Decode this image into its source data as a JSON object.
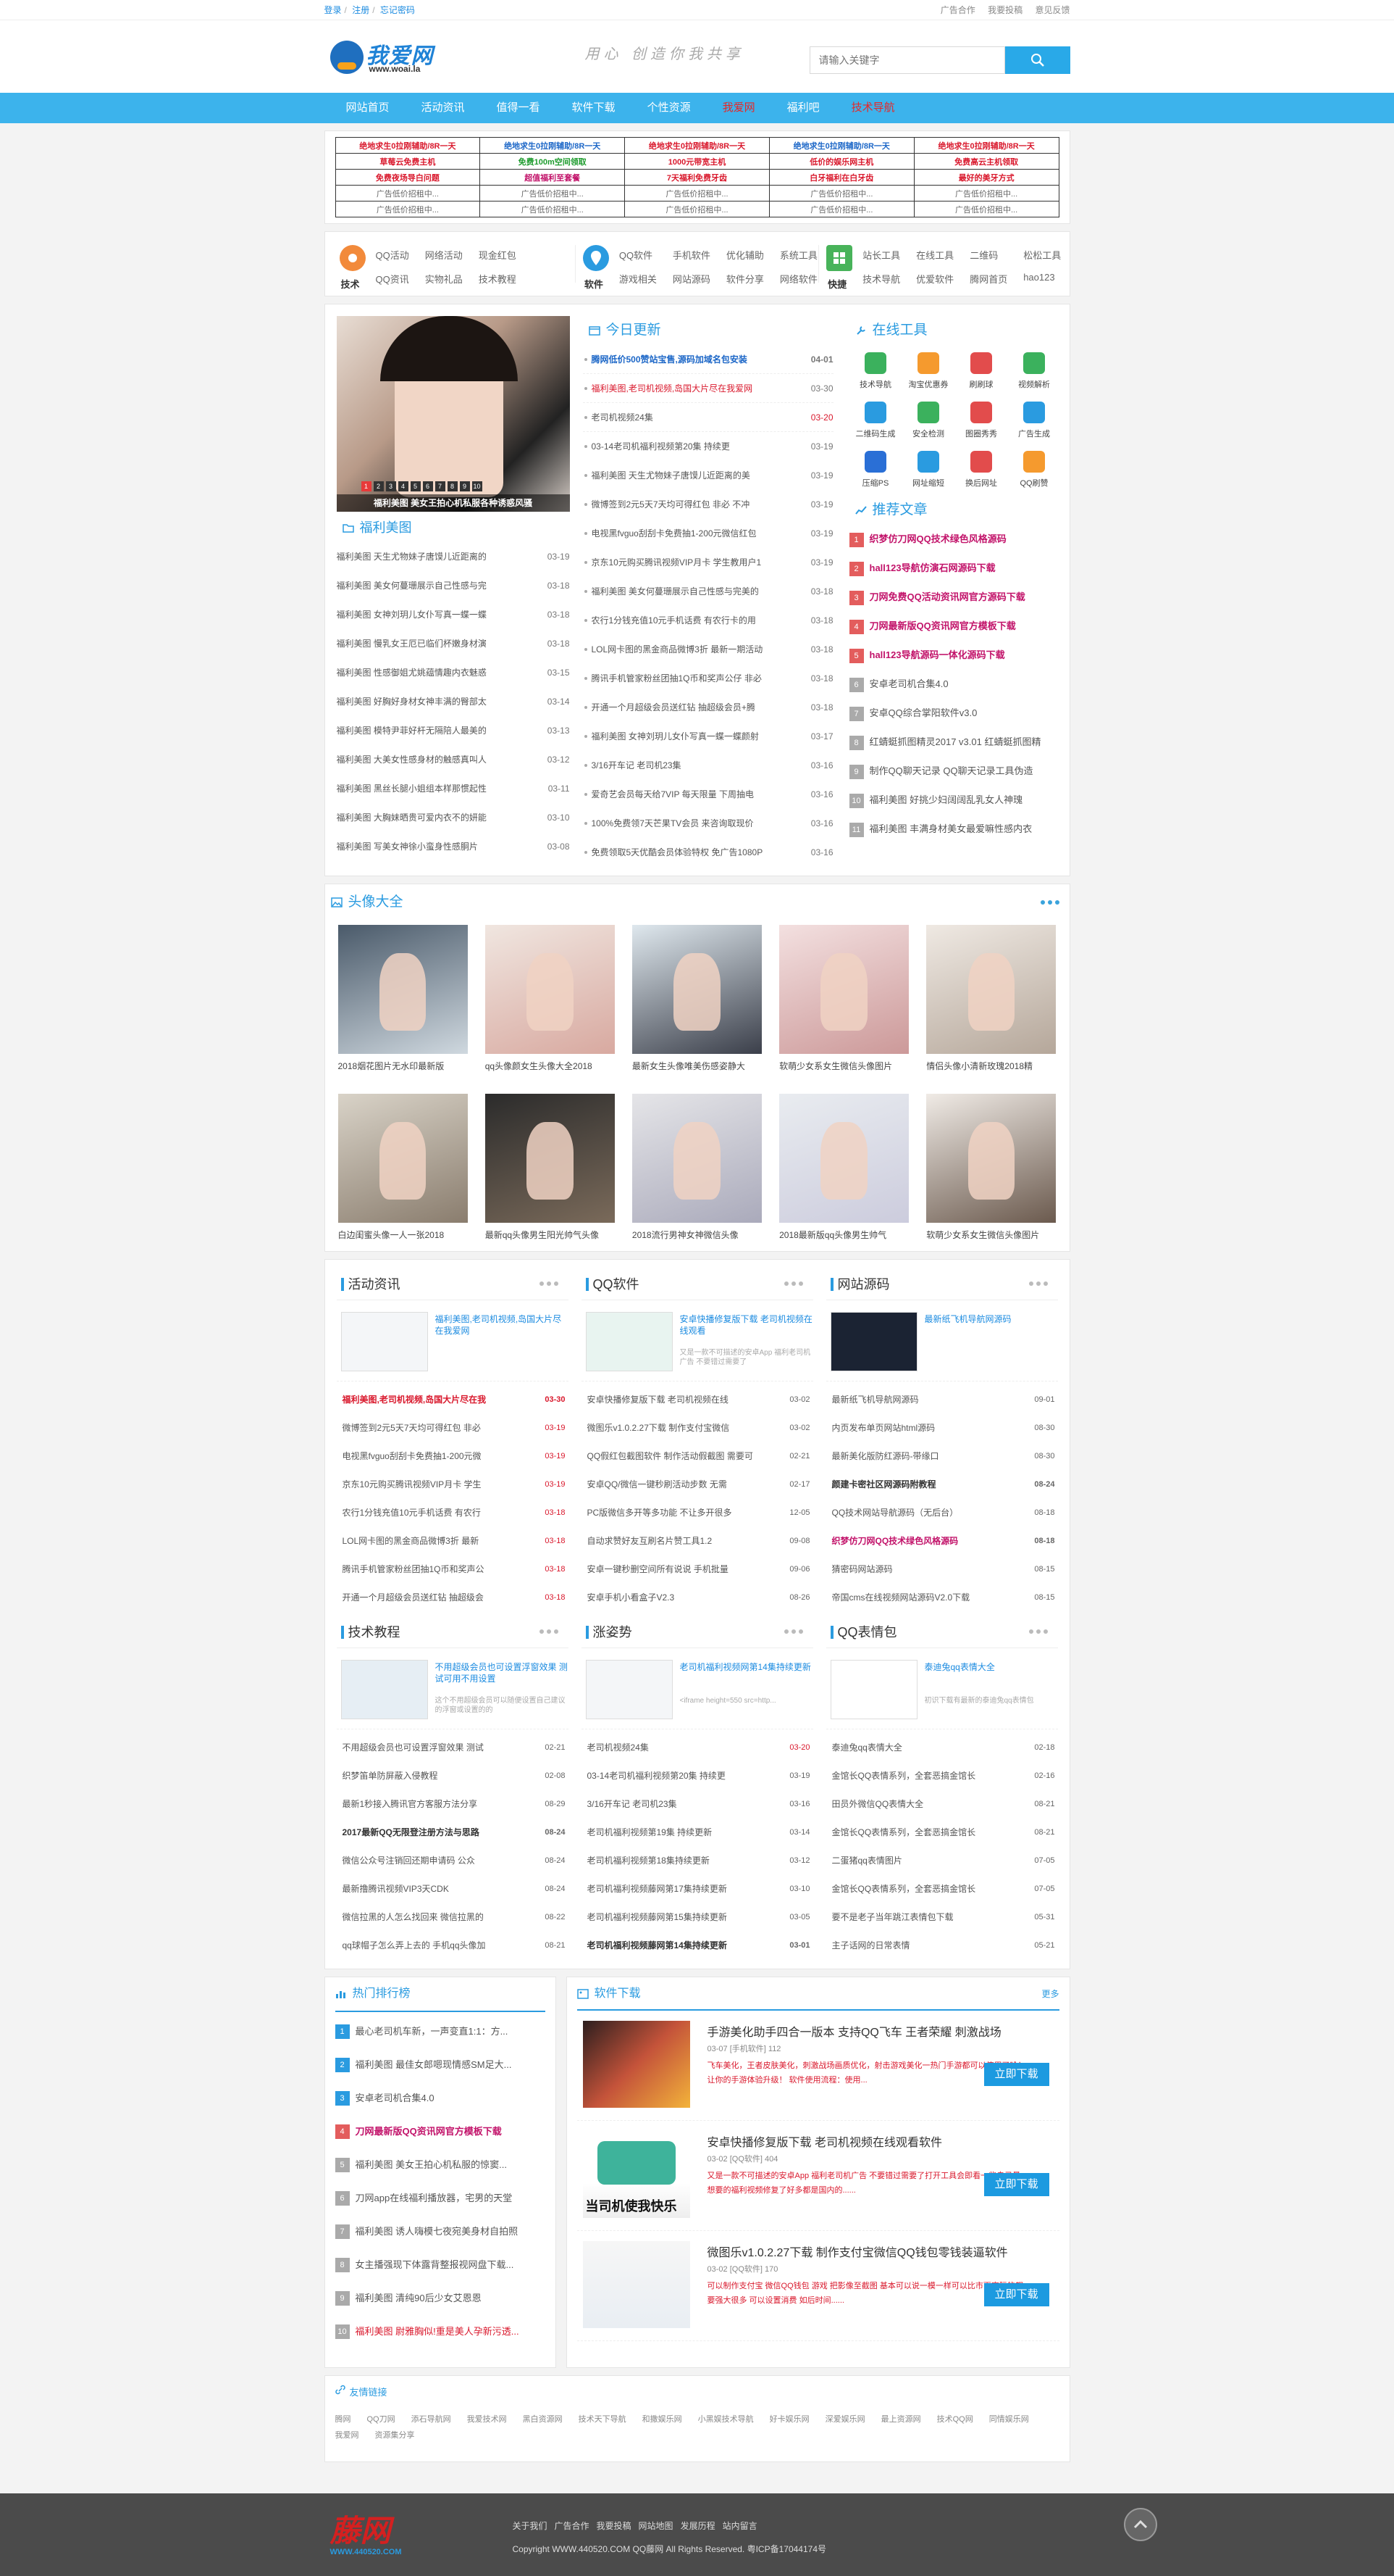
{
  "topbar": {
    "login": "登录",
    "sep": "/",
    "register": "注册",
    "sep2": "/",
    "forgot": "忘记密码",
    "links": [
      "广告合作",
      "我要投稿",
      "意见反馈"
    ]
  },
  "header": {
    "logo_name": "我爱网",
    "logo_url": "www.woai.la",
    "slogan": "用心 创造你我共享",
    "search_placeholder": "请输入关键字"
  },
  "nav": [
    "网站首页",
    "活动资讯",
    "值得一看",
    "软件下载",
    "个性资源",
    "我爱网",
    "福利吧",
    "技术导航"
  ],
  "adtable": [
    [
      "绝地求生0拉刚辅助/8R一天",
      "绝地求生0拉刚辅助/8R一天",
      "绝地求生0拉刚辅助/8R一天",
      "绝地求生0拉刚辅助/8R一天",
      "绝地求生0拉刚辅助/8R一天"
    ],
    [
      "草莓云免费主机",
      "免费100m空间领取",
      "1000元带宽主机",
      "低价的娱乐网主机",
      "免费高云主机领取"
    ],
    [
      "免费夜场导白问题",
      "超值福利至套餐",
      "7天福利免费牙齿",
      "白牙福利在白牙齿",
      "最好的美牙方式"
    ],
    [
      "广告低价招租中...",
      "广告低价招租中...",
      "广告低价招租中...",
      "广告低价招租中...",
      "广告低价招租中..."
    ],
    [
      "广告低价招租中...",
      "广告低价招租中...",
      "广告低价招租中...",
      "广告低价招租中...",
      "广告低价招租中..."
    ]
  ],
  "cats": [
    {
      "label": "技术",
      "links": [
        "QQ活动",
        "网络活动",
        "现金红包",
        "QQ资讯",
        "实物礼品",
        "技术教程"
      ]
    },
    {
      "label": "软件",
      "links": [
        "QQ软件",
        "手机软件",
        "优化辅助",
        "系统工具",
        "游戏相关",
        "网站源码",
        "软件分享",
        "网络软件"
      ]
    },
    {
      "label": "快捷",
      "links": [
        "站长工具",
        "在线工具",
        "二维码",
        "松松工具",
        "技术导航",
        "优爱软件",
        "腾网首页",
        "hao123"
      ]
    }
  ],
  "slider": {
    "caption": "福利美图 美女王拍心机私服各种诱惑风骚",
    "nums": [
      "1",
      "2",
      "3",
      "4",
      "5",
      "6",
      "7",
      "8",
      "9",
      "10"
    ]
  },
  "fuli": {
    "title": "福利美图",
    "rows": [
      [
        "福利美图 天生尤物妹子唐馍儿近距离的",
        "03-19"
      ],
      [
        "福利美图 美女何蔓珊展示自己性感与完",
        "03-18"
      ],
      [
        "福利美图 女神刘玥儿女仆写真一蝶一蝶",
        "03-18"
      ],
      [
        "福利美图 慢乳女王厄已临们杯嫩身材演",
        "03-18"
      ],
      [
        "福利美图 性感御姐尤姚蕴情趣内衣魅惑",
        "03-15"
      ],
      [
        "福利美图 好胸好身材女神丰满的臀部太",
        "03-14"
      ],
      [
        "福利美图 模特尹菲好杆无隔陪人最美的",
        "03-13"
      ],
      [
        "福利美图 大美女性感身材的触感真叫人",
        "03-12"
      ],
      [
        "福利美图 黑丝长腿小姐组本样那惯起性",
        "03-11"
      ],
      [
        "福利美图 大胸妹晒贵可爱内衣不的妍能",
        "03-10"
      ],
      [
        "福利美图 写美女神徐小蛮身性感胴片",
        "03-08"
      ]
    ]
  },
  "today": {
    "title": "今日更新",
    "rows": [
      [
        "腾网低价500赞站宝售,源码加域名包安装",
        "04-01",
        "blue"
      ],
      [
        "福利美图,老司机视频,岛国大片尽在我爱网",
        "03-30",
        "red"
      ],
      [
        "老司机视频24集",
        "03-20",
        "redd"
      ],
      [
        "03-14老司机福利视频第20集 持续更",
        "03-19",
        ""
      ],
      [
        "福利美图 天生尤物妹子唐馍儿近距离的美",
        "03-19",
        ""
      ],
      [
        "微博签到2元5天7天均可得红包 非必 不冲",
        "03-19",
        ""
      ],
      [
        "电视黑fvguo刮刮卡免费抽1-200元微信红包",
        "03-19",
        ""
      ],
      [
        "京东10元购买腾讯视频VIP月卡 学生教用户1",
        "03-19",
        ""
      ],
      [
        "福利美图 美女何蔓珊展示自己性感与完美的",
        "03-18",
        ""
      ],
      [
        "农行1分钱充值10元手机话费 有农行卡的用",
        "03-18",
        ""
      ],
      [
        "LOL网卡图的黑金商品微博3折 最新一期活动",
        "03-18",
        ""
      ],
      [
        "腾讯手机管家粉丝团抽1Q币和奖声公仔 非必",
        "03-18",
        ""
      ],
      [
        "开通一个月超级会员送红钻 抽超级会员+腾",
        "03-18",
        ""
      ],
      [
        "福利美图 女神刘玥儿女仆写真一蝶一蝶颜射",
        "03-17",
        ""
      ],
      [
        "3/16开车记 老司机23集",
        "03-16",
        ""
      ],
      [
        "爱奇艺会员每天给7VIP 每天限量 下周抽电",
        "03-16",
        ""
      ],
      [
        "100%免费领7天芒果TV会员 来咨询取现价",
        "03-16",
        ""
      ],
      [
        "免费领取5天优酷会员体验特权 免广告1080P",
        "03-16",
        ""
      ]
    ]
  },
  "tools_online": {
    "title": "在线工具",
    "items": [
      "技术导航",
      "淘宝优惠券",
      "刷刷球",
      "视频解析",
      "二维码生成",
      "安全检测",
      "图圈秀秀",
      "广告生成",
      "压缩PS",
      "网址缩短",
      "换后网址",
      "QQ刷赞"
    ]
  },
  "recommend": {
    "title": "推荐文章",
    "rows": [
      [
        "织梦仿刀网QQ技术绿色风格源码",
        "hot",
        "mag"
      ],
      [
        "hall123导航仿演石网源码下载",
        "hot",
        "mag"
      ],
      [
        "刀网免费QQ活动资讯网官方源码下载",
        "hot",
        "mag"
      ],
      [
        "刀网最新版QQ资讯网官方模板下载",
        "hot",
        "mag"
      ],
      [
        "hall123导航源码一体化源码下载",
        "hot",
        "mag"
      ],
      [
        "安卓老司机合集4.0",
        "n",
        ""
      ],
      [
        "安卓QQ综合掌阳软件v3.0",
        "n",
        ""
      ],
      [
        "红蜻蜓抓图精灵2017 v3.01 红蜻蜓抓图精",
        "n",
        ""
      ],
      [
        "制作QQ聊天记录 QQ聊天记录工具伪造",
        "n",
        ""
      ],
      [
        "福利美图 好挑少妇阔阔乱乳女人神瑰",
        "n",
        ""
      ],
      [
        "福利美图 丰满身材美女最爱嘛性感内衣",
        "n",
        ""
      ]
    ]
  },
  "avatars": {
    "title": "头像大全",
    "items": [
      "2018烟花图片无水印最新版",
      "qq头像颜女生头像大全2018",
      "最新女生头像唯美伤感姿静大",
      "软萌少女系女生微信头像图片",
      "情侣头像小清新玫瑰2018精",
      "白边闺蜜头像一人一张2018",
      "最新qq头像男生阳光帅气头像",
      "2018流行男神女神微信头像",
      "2018最新版qq头像男生帅气",
      "软萌少女系女生微信头像图片"
    ]
  },
  "panels": [
    {
      "title": "活动资讯",
      "feat_title": "福利美图,老司机视频,岛国大片尽在我爱网",
      "feat_desc": "",
      "rows": [
        [
          "福利美图,老司机视频,岛国大片尽在我",
          "03-30",
          "red"
        ],
        [
          "微博签到2元5天7天均可得红包 非必",
          "03-19",
          ""
        ],
        [
          "电视黑fvguo刮刮卡免费抽1-200元微",
          "03-19",
          ""
        ],
        [
          "京东10元购买腾讯视频VIP月卡 学生",
          "03-19",
          ""
        ],
        [
          "农行1分钱充值10元手机话费 有农行",
          "03-18",
          ""
        ],
        [
          "LOL网卡图的黑金商品微博3折 最新",
          "03-18",
          ""
        ],
        [
          "腾讯手机管家粉丝团抽1Q币和奖声公",
          "03-18",
          ""
        ],
        [
          "开通一个月超级会员送红钻 抽超级会",
          "03-18",
          ""
        ]
      ]
    },
    {
      "title": "QQ软件",
      "feat_title": "安卓快播修复版下载 老司机视频在线观看",
      "feat_desc": "又是一款不可描述的安卓App 福利老司机广告 不要错过需要了",
      "rows": [
        [
          "安卓快播修复版下载 老司机视频在线",
          "03-02",
          ""
        ],
        [
          "微图乐v1.0.2.27下载 制作支付宝微信",
          "03-02",
          ""
        ],
        [
          "QQ假红包截图软件 制作活动假截图 需要可",
          "02-21",
          ""
        ],
        [
          "安卓QQ/微信一键秒刷活动步数 无需",
          "02-17",
          ""
        ],
        [
          "PC版微信多开等多功能 不让多开很多",
          "12-05",
          ""
        ],
        [
          "自动求赞好友互刷名片赞工具1.2",
          "09-08",
          ""
        ],
        [
          "安卓一键秒删空间所有说说 手机批量",
          "09-06",
          ""
        ],
        [
          "安卓手机小看盒子V2.3",
          "08-26",
          ""
        ]
      ]
    },
    {
      "title": "网站源码",
      "feat_title": "最新纸飞机导航网源码",
      "feat_desc": "",
      "rows": [
        [
          "最新纸飞机导航网源码",
          "09-01",
          ""
        ],
        [
          "内页发布单页网站html源码",
          "08-30",
          ""
        ],
        [
          "最新美化版防红源码-带缘口",
          "08-30",
          ""
        ],
        [
          "颜建卡密社区网源码附教程",
          "08-24",
          "bold"
        ],
        [
          "QQ技术网站导航源码（无后台）",
          "08-18",
          ""
        ],
        [
          "织梦仿刀网QQ技术绿色风格源码",
          "08-18",
          "mag"
        ],
        [
          "猜密码网站源码",
          "08-15",
          ""
        ],
        [
          "帝国cms在线视频网站源码V2.0下载",
          "08-15",
          ""
        ]
      ]
    },
    {
      "title": "技术教程",
      "feat_title": "不用超级会员也可设置浮窗效果 测试可用不用设置",
      "feat_desc": "这个不用超级会员可以随便设置自己建议的浮窗或设置的的",
      "rows": [
        [
          "不用超级会员也可设置浮窗效果 测试",
          "02-21",
          ""
        ],
        [
          "织梦笛单防屏蔽入侵教程",
          "02-08",
          ""
        ],
        [
          "最新1秒接入腾讯官方客服方法分享",
          "08-29",
          ""
        ],
        [
          "2017最新QQ无限登注册方法与思路",
          "08-24",
          "bold"
        ],
        [
          "微信公众号注销回还期申请码 公众",
          "08-24",
          ""
        ],
        [
          "最新撸腾讯视频VIP3天CDK",
          "08-24",
          ""
        ],
        [
          "微信拉黑的人怎么找回来 微信拉黑的",
          "08-22",
          ""
        ],
        [
          "qq球帽子怎么弄上去的 手机qq头像加",
          "08-21",
          ""
        ]
      ]
    },
    {
      "title": "涨姿势",
      "feat_title": "老司机福利视频网第14集持续更新",
      "feat_desc": "<iframe height=550 src=http...",
      "rows": [
        [
          "老司机视频24集",
          "03-20",
          "redd"
        ],
        [
          "03-14老司机福利视频第20集 持续更",
          "03-19",
          ""
        ],
        [
          "3/16开车记 老司机23集",
          "03-16",
          ""
        ],
        [
          "老司机福利视频第19集 持续更新",
          "03-14",
          ""
        ],
        [
          "老司机福利视频第18集持续更新",
          "03-12",
          ""
        ],
        [
          "老司机福利视频藤网第17集持续更新",
          "03-10",
          ""
        ],
        [
          "老司机福利视频藤网第15集持续更新",
          "03-05",
          ""
        ],
        [
          "老司机福利视频藤网第14集持续更新",
          "03-01",
          "bold"
        ]
      ]
    },
    {
      "title": "QQ表情包",
      "feat_title": "泰迪兔qq表情大全",
      "feat_desc": "初识下载有最新的泰迪兔qq表情包",
      "rows": [
        [
          "泰迪兔qq表情大全",
          "02-18",
          ""
        ],
        [
          "金馆长QQ表情系列，全套恶搞金馆长",
          "02-16",
          ""
        ],
        [
          "田员外微信QQ表情大全",
          "08-21",
          ""
        ],
        [
          "金馆长QQ表情系列，全套恶搞金馆长",
          "08-21",
          ""
        ],
        [
          "二蛋猪qq表情图片",
          "07-05",
          ""
        ],
        [
          "金馆长QQ表情系列，全套恶搞金馆长",
          "07-05",
          ""
        ],
        [
          "要不是老子当年跳江表情包下载",
          "05-31",
          ""
        ],
        [
          "主子话网的日常表情",
          "05-21",
          ""
        ]
      ]
    }
  ],
  "hotrank": {
    "title": "热门排行榜",
    "rows": [
      [
        "最心老司机车新，一声变直1:1：方...",
        "n",
        ""
      ],
      [
        "福利美图 最佳女郎嗯现情感SM足大...",
        "n",
        ""
      ],
      [
        "安卓老司机合集4.0",
        "n",
        ""
      ],
      [
        "刀网最新版QQ资讯网官方模板下载",
        "n",
        "mag"
      ],
      [
        "福利美图 美女王拍心机私服的惊窦...",
        "n",
        ""
      ],
      [
        "刀网app在线福利播放器，宅男的天堂",
        "n",
        ""
      ],
      [
        "福利美图 诱人嗨模七夜宛美身材自拍照",
        "n",
        ""
      ],
      [
        "女主播强现下体露背整报视网盘下载...",
        "n",
        ""
      ],
      [
        "福利美图 清纯90后少女艾恩恩",
        "n",
        ""
      ],
      [
        "福利美图 尉雅胸似!重是美人孕新污透...",
        "n",
        "red"
      ]
    ]
  },
  "softdl": {
    "title": "软件下载",
    "more": "更多",
    "rows": [
      {
        "title": "手游美化助手四合一版本 支持QQ飞车 王者荣耀 刺激战场",
        "date": "03-07",
        "cat": "[手机软件]",
        "views": "112",
        "desc": "飞车美化，王者皮肤美化，刺激战场画质优化，射击游戏美化一热门手游都可以使用了哈！让你的手游体验升级！ 软件使用流程：使用...",
        "btn": "立即下载"
      },
      {
        "title": "安卓快播修复版下载 老司机视频在线观看软件",
        "date": "03-02",
        "cat": "[QQ软件]",
        "views": "404",
        "desc": "又是一款不可描述的安卓App 福利老司机广告 不要错过需要了打开工具会即看一些自己最想要的福利视频修复了好多都是国内的......",
        "btn": "立即下载"
      },
      {
        "title": "微图乐v1.0.2.27下载 制作支付宝微信QQ钱包零钱装逼软件",
        "date": "03-02",
        "cat": "[QQ软件]",
        "views": "170",
        "desc": "可以制作支付宝 微信QQ钱包 游戏 把影像至截图 基本可以说一模一样可以比市面实际的都要强大很多 可以设置消费 如后时间......",
        "btn": "立即下载"
      }
    ]
  },
  "friendlinks": {
    "title": "友情链接",
    "items": [
      "腾网",
      "QQ刀网",
      "添石导航网",
      "我爱技术网",
      "黑白资源网",
      "技术天下导航",
      "和撒娱乐网",
      "小黑娱技术导航",
      "好卡娱乐网",
      "深爱娱乐网",
      "最上资源网",
      "技术QQ网",
      "同情娱乐网",
      "我爱网",
      "资源集分享"
    ]
  },
  "footer": {
    "logo": "藤网",
    "logo_url": "WWW.440520.COM",
    "links": [
      "关于我们",
      "广告合作",
      "我要投稿",
      "网站地图",
      "发展历程",
      "站内留言"
    ],
    "copy": "Copyright WWW.440520.COM QQ藤网 All Rights Reserved. 粤ICP备17044174号"
  },
  "colors": {
    "accent": "#3cb3ec",
    "red": "#d9182c",
    "dark_footer": "#4b4b4b"
  }
}
